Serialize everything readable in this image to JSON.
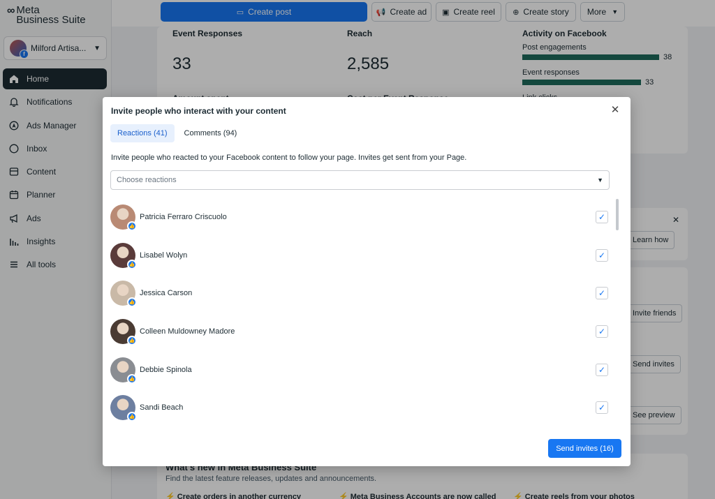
{
  "app": {
    "logo_brand": "Meta",
    "logo_product": "Business Suite"
  },
  "sidebar": {
    "account_name": "Milford Artisa...",
    "items": [
      {
        "label": "Home",
        "icon": "home-icon",
        "active": true,
        "dot": false
      },
      {
        "label": "Notifications",
        "icon": "bell-icon",
        "active": false,
        "dot": true
      },
      {
        "label": "Ads Manager",
        "icon": "compass-icon",
        "active": false,
        "dot": false
      },
      {
        "label": "Inbox",
        "icon": "chat-icon",
        "active": false,
        "dot": true
      },
      {
        "label": "Content",
        "icon": "content-icon",
        "active": false,
        "dot": false
      },
      {
        "label": "Planner",
        "icon": "calendar-icon",
        "active": false,
        "dot": false
      },
      {
        "label": "Ads",
        "icon": "megaphone-icon",
        "active": false,
        "dot": false
      },
      {
        "label": "Insights",
        "icon": "bar-chart-icon",
        "active": false,
        "dot": false
      },
      {
        "label": "All tools",
        "icon": "menu-icon",
        "active": false,
        "dot": false
      }
    ]
  },
  "toolbar": {
    "create_post": "Create post",
    "create_ad": "Create ad",
    "create_reel": "Create reel",
    "create_story": "Create story",
    "more": "More"
  },
  "background": {
    "event_responses_label": "Event Responses",
    "event_responses_value": "33",
    "reach_label": "Reach",
    "reach_value": "2,585",
    "amount_spent_label": "Amount spent",
    "cost_per_label": "Cost per Event Response",
    "activity_title": "Activity on Facebook",
    "post_engagements_label": "Post engagements",
    "post_engagements_value": "38",
    "event_responses_bar_label": "Event responses",
    "event_responses_bar_value": "33",
    "link_clicks_label": "Link clicks",
    "learn_how": "Learn how",
    "invite_friends": "Invite friends",
    "send_invites": "Send invites",
    "see_preview": "See preview",
    "whats_new_title": "What's new in Meta Business Suite",
    "whats_new_sub": "Find the latest feature releases, updates and announcements.",
    "news_1": "Create orders in another currency",
    "news_2": "Meta Business Accounts are now called",
    "news_3": "Create reels from your photos"
  },
  "modal": {
    "title": "Invite people who interact with your content",
    "tabs": [
      {
        "label": "Reactions (41)",
        "active": true
      },
      {
        "label": "Comments (94)",
        "active": false
      }
    ],
    "description": "Invite people who reacted to your Facebook content to follow your page. Invites get sent from your Page.",
    "select_placeholder": "Choose reactions",
    "people": [
      {
        "name": "Patricia Ferraro Criscuolo",
        "checked": true,
        "color": "#b98a74"
      },
      {
        "name": "Lisabel Wolyn",
        "checked": true,
        "color": "#5a3b3a"
      },
      {
        "name": "Jessica Carson",
        "checked": true,
        "color": "#c9b9a7"
      },
      {
        "name": "Colleen Muldowney Madore",
        "checked": true,
        "color": "#4a3b33"
      },
      {
        "name": "Debbie Spinola",
        "checked": true,
        "color": "#8a8d92"
      },
      {
        "name": "Sandi Beach",
        "checked": true,
        "color": "#6d7fa0"
      }
    ],
    "send_button": "Send invites (16)"
  },
  "colors": {
    "accent": "#1877f2",
    "dark": "#1c2b33",
    "bar": "#1e6b5c"
  }
}
